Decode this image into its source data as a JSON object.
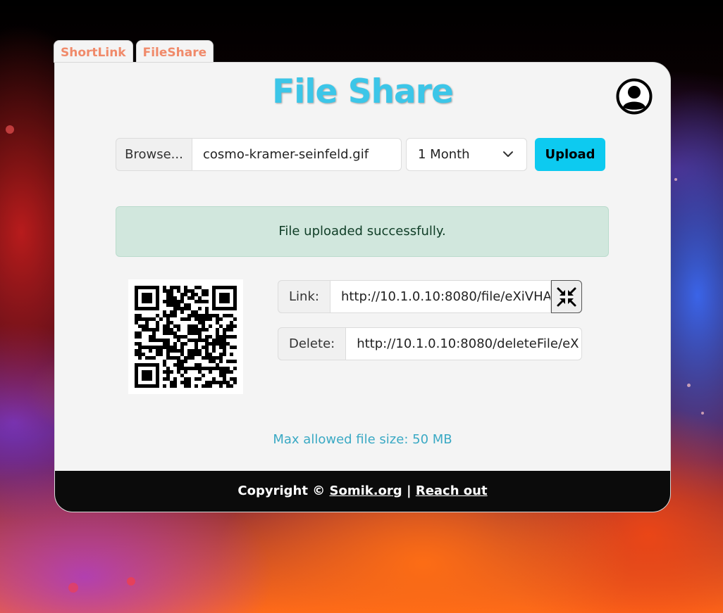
{
  "tabs": [
    "ShortLink",
    "FileShare"
  ],
  "title": "File Share",
  "upload": {
    "browse_label": "Browse...",
    "file_name": "cosmo-kramer-seinfeld.gif",
    "expiry": "1 Month",
    "upload_label": "Upload"
  },
  "alert": "File uploaded successfully.",
  "result": {
    "link_label": "Link:",
    "link_value": "http://10.1.0.10:8080/file/eXiVHA",
    "delete_label": "Delete:",
    "delete_value": "http://10.1.0.10:8080/deleteFile/eX"
  },
  "max_size": "Max allowed file size: 50 MB",
  "footer": {
    "copyright": "Copyright ©",
    "site_link": "Somik.org",
    "separator": "|",
    "contact_link": "Reach out"
  },
  "colors": {
    "title": "#3cc6e8",
    "tab_text": "#f08a6a",
    "upload_button": "#0dcaf0",
    "alert_bg": "#d1e7dd",
    "footer_bg": "#0b0b0b"
  },
  "icons": {
    "avatar": "user-circle-icon",
    "select": "chevron-down-icon",
    "shrink": "compress-arrows-icon"
  }
}
